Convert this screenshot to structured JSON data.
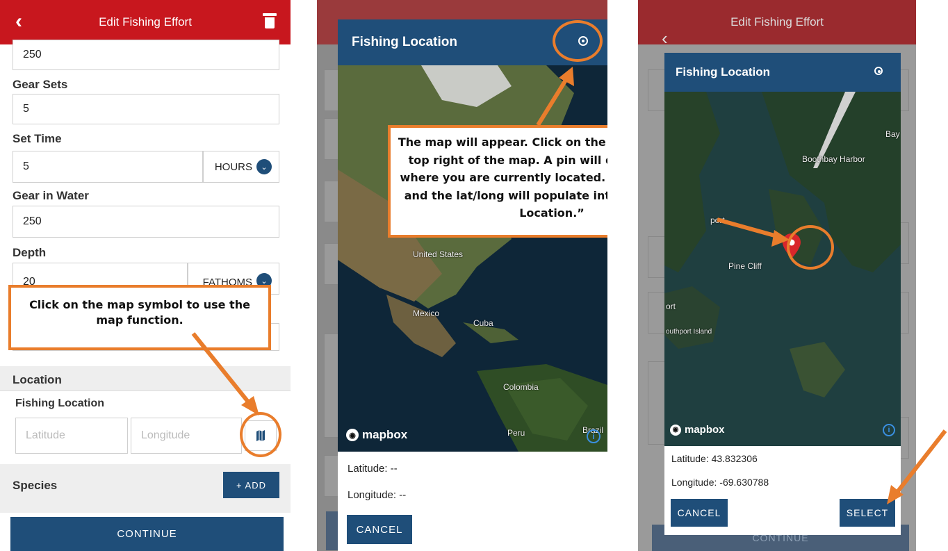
{
  "panel1": {
    "header_title": "Edit Fishing Effort",
    "fields": {
      "top_value": "250",
      "gear_sets_label": "Gear Sets",
      "gear_sets_value": "5",
      "set_time_label": "Set Time",
      "set_time_value": "5",
      "set_time_unit": "HOURS",
      "gear_in_water_label": "Gear in Water",
      "gear_in_water_value": "250",
      "depth_label": "Depth",
      "depth_value": "20",
      "depth_unit": "FATHOMS"
    },
    "callout": "Click on the map symbol to use the map function.",
    "location_section": "Location",
    "fishing_location_label": "Fishing Location",
    "latitude_placeholder": "Latitude",
    "longitude_placeholder": "Longitude",
    "species_label": "Species",
    "add_button": "+ ADD",
    "continue_button": "CONTINUE"
  },
  "panel2": {
    "modal_title": "Fishing Location",
    "callout": "The map will appear. Click on the compass at the top right of the map. A pin will drop based on where you are currently located. Click “SELECT” and the lat/long will populate into the “Fishing Location.”",
    "places": [
      "United States",
      "Mexico",
      "Cuba",
      "Colombia",
      "Peru",
      "Brazil"
    ],
    "mapbox": "mapbox",
    "latitude_text": "Latitude: --",
    "longitude_text": "Longitude: --",
    "cancel_button": "CANCEL"
  },
  "panel3": {
    "header_title": "Edit Fishing Effort",
    "modal_title": "Fishing Location",
    "places": [
      "Boothbay Harbor",
      "Pine Cliff",
      "outhport Island",
      "ort",
      "Bay",
      "port"
    ],
    "mapbox": "mapbox",
    "latitude_text": "Latitude: 43.832306",
    "longitude_text": "Longitude: -69.630788",
    "cancel_button": "CANCEL",
    "select_button": "SELECT",
    "continue_button": "CONTINUE"
  },
  "colors": {
    "header_red": "#c8171e",
    "navy": "#1f4e79",
    "callout_orange": "#e97d2c",
    "pin_red": "#d9262b"
  }
}
